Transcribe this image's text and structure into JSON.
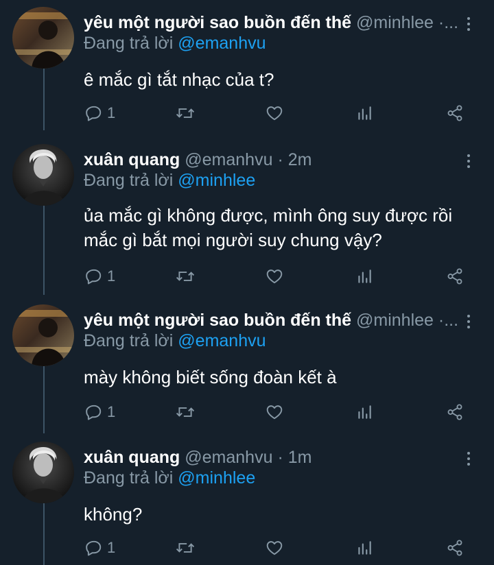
{
  "tweets": [
    {
      "name": "yêu một người sao buồn đến thế",
      "handle": "@minhlee",
      "meta": "·...",
      "replying_prefix": "Đang trả lời",
      "replying_to": "@emanhvu",
      "text": "ê mắc gì tắt nhạc của t?",
      "reply_count": "1",
      "avatar": "minhlee-avatar"
    },
    {
      "name": "xuân quang",
      "handle": "@emanhvu",
      "meta": "· 2m",
      "replying_prefix": "Đang trả lời",
      "replying_to": "@minhlee",
      "text_lines": [
        "ủa mắc gì không được, mình ông suy được rồi",
        "mắc gì bắt mọi người suy chung vậy?"
      ],
      "reply_count": "1",
      "avatar": "emanhvu-avatar"
    },
    {
      "name": "yêu một người sao buồn đến thế",
      "handle": "@minhlee",
      "meta": "·...",
      "replying_prefix": "Đang trả lời",
      "replying_to": "@emanhvu",
      "text": "mày không biết sống đoàn kết à",
      "reply_count": "1",
      "avatar": "minhlee-avatar"
    },
    {
      "name": "xuân quang",
      "handle": "@emanhvu",
      "meta": "· 1m",
      "replying_prefix": "Đang trả lời",
      "replying_to": "@minhlee",
      "text": "không?",
      "reply_count": "1",
      "avatar": "emanhvu-avatar"
    }
  ],
  "icons": {
    "reply": "reply-icon",
    "retweet": "retweet-icon",
    "like": "heart-icon",
    "analytics": "analytics-icon",
    "share": "share-icon",
    "more": "more-options-icon"
  },
  "colors": {
    "background": "#15202b",
    "text": "#ffffff",
    "secondary": "#8899a6",
    "mention": "#1da1f2",
    "thread_line": "#3d5466"
  }
}
